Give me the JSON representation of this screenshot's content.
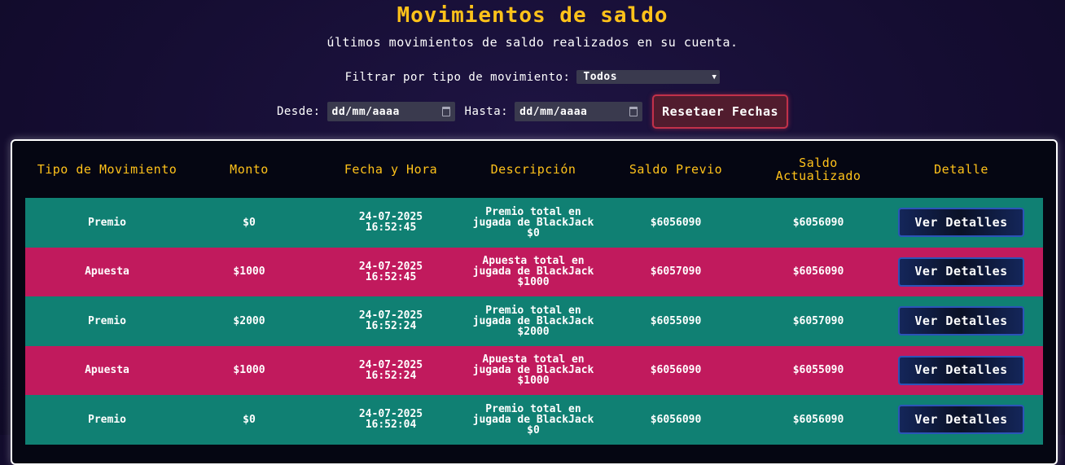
{
  "header": {
    "title": "Movimientos de saldo",
    "subtitle": "últimos movimientos de saldo realizados en su cuenta."
  },
  "filter": {
    "label": "Filtrar por tipo de movimiento:",
    "selected": "Todos"
  },
  "dates": {
    "from_label": "Desde:",
    "from_placeholder": "dd/mm/aaaa",
    "to_label": "Hasta:",
    "to_placeholder": "dd/mm/aaaa",
    "reset_label": "Resetaer Fechas"
  },
  "table": {
    "headers": [
      "Tipo de Movimiento",
      "Monto",
      "Fecha y Hora",
      "Descripción",
      "Saldo Previo",
      "Saldo Actualizado",
      "Detalle"
    ],
    "detail_button_label": "Ver Detalles",
    "rows": [
      {
        "tipo": "Premio",
        "monto": "$0",
        "fecha": "24-07-2025",
        "hora": "16:52:45",
        "descripcion": "Premio total en jugada de BlackJack $0",
        "saldo_previo": "$6056090",
        "saldo_actualizado": "$6056090",
        "color": "teal"
      },
      {
        "tipo": "Apuesta",
        "monto": "$1000",
        "fecha": "24-07-2025",
        "hora": "16:52:45",
        "descripcion": "Apuesta total en jugada de BlackJack $1000",
        "saldo_previo": "$6057090",
        "saldo_actualizado": "$6056090",
        "color": "pink"
      },
      {
        "tipo": "Premio",
        "monto": "$2000",
        "fecha": "24-07-2025",
        "hora": "16:52:24",
        "descripcion": "Premio total en jugada de BlackJack $2000",
        "saldo_previo": "$6055090",
        "saldo_actualizado": "$6057090",
        "color": "teal"
      },
      {
        "tipo": "Apuesta",
        "monto": "$1000",
        "fecha": "24-07-2025",
        "hora": "16:52:24",
        "descripcion": "Apuesta total en jugada de BlackJack $1000",
        "saldo_previo": "$6056090",
        "saldo_actualizado": "$6055090",
        "color": "pink"
      },
      {
        "tipo": "Premio",
        "monto": "$0",
        "fecha": "24-07-2025",
        "hora": "16:52:04",
        "descripcion": "Premio total en jugada de BlackJack $0",
        "saldo_previo": "$6056090",
        "saldo_actualizado": "$6056090",
        "color": "teal"
      }
    ]
  },
  "colors": {
    "accent": "#ffc21a",
    "row_teal": "#108073",
    "row_pink": "#c11a5d",
    "reset_border": "#c2314a",
    "button_border": "#2b54b8"
  }
}
